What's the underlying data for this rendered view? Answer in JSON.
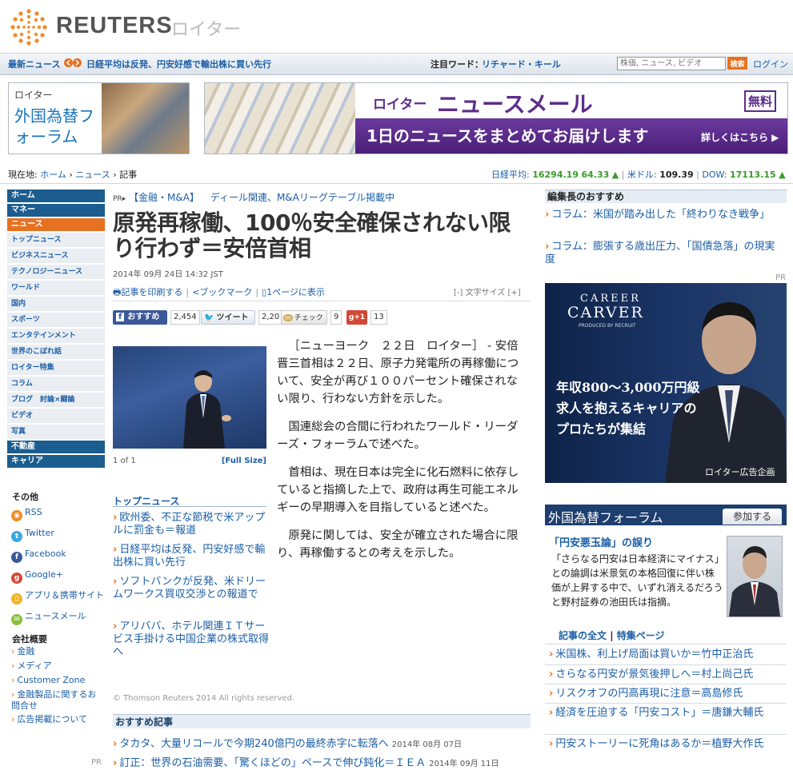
{
  "header": {
    "logo_text": "REUTERS",
    "logo_jp": "ロイター"
  },
  "topbar": {
    "breaking_label": "最新ニュース",
    "breaking_headline": "日経平均は反発、円安好感で輸出株に買い先行",
    "watch_label": "注目ワード：",
    "watch_word": "リチャード・キール",
    "search_placeholder": "株価, ニュース, ビデオ",
    "search_button": "検索",
    "login": "ログイン"
  },
  "banners": {
    "fx_reuters": "ロイター",
    "fx_title": "外国為替フォーラム",
    "mail_reuters": "ロイター",
    "mail_title": "ニュースメール",
    "mail_free": "無料",
    "mail_tagline": "1日のニュースをまとめてお届けします",
    "mail_more": "詳しくはこちら ▶"
  },
  "breadcrumb": {
    "label": "現在地: ",
    "items": [
      "ホーム",
      "ニュース",
      "記事"
    ],
    "sep": " › "
  },
  "markets": {
    "nikkei_label": "日経平均:",
    "nikkei_value": "16294.19",
    "nikkei_change": "64.33",
    "usd_label": "米ドル:",
    "usd_value": "109.39",
    "dow_label": "DOW:",
    "dow_value": "17113.15"
  },
  "leftnav": {
    "home": "ホーム",
    "money": "マネー",
    "news": "ニュース",
    "items": [
      "トップニュース",
      "ビジネスニュース",
      "テクノロジーニュース",
      "ワールド",
      "国内",
      "スポーツ",
      "エンタテインメント",
      "世界のこぼれ話",
      "ロイター特集",
      "コラム",
      "ブログ　討論×闘論",
      "ビデオ",
      "写真"
    ],
    "realestate": "不動産",
    "career": "キャリア",
    "other_title": "その他",
    "social": [
      "RSS",
      "Twitter",
      "Facebook",
      "Google+",
      "アプリ＆携帯サイト",
      "ニュースメール"
    ],
    "company_title": "会社概要",
    "company_items": [
      "金融",
      "メディア",
      "Customer Zone",
      "金融製品に関するお問合せ",
      "広告掲載について"
    ],
    "pr": "PR"
  },
  "article": {
    "pr_badge": "PR",
    "pr_tag": "【金融・M&A】",
    "pr_text": "ディール関連、M&Aリーグテーブル掲載中",
    "headline": "原発再稼働、100％安全確保されない限り行わず＝安倍首相",
    "date": "2014年 09月 24日 14:32 JST",
    "print": "記事を印刷する",
    "bookmark": "ブックマーク",
    "onepage": "1ページに表示",
    "font_size": "[-] 文字サイズ [+]",
    "share": {
      "fb_label": "おすすめ",
      "fb_count": "2,454",
      "tw_label": "ツイート",
      "tw_count": "2,20",
      "hatena_label": "チェック",
      "hatena_count": "9",
      "gplus_label": "g+1",
      "gplus_count": "13"
    },
    "photo_count": "1 of 1",
    "photo_full": "[Full Size]",
    "paragraphs": [
      "［ニューヨーク　２２日　ロイター］ - 安倍晋三首相は２２日、原子力発電所の再稼働について、安全が再び１００パーセント確保されない限り、行わない方針を示した。",
      "国連総会の合間に行われたワールド・リーダーズ・フォーラムで述べた。",
      "首相は、現在日本は完全に化石燃料に依存していると指摘した上で、政府は再生可能エネルギーの早期導入を目指していると述べた。",
      "原発に関しては、安全が確立された場合に限り、再稼働するとの考えを示した。"
    ],
    "copyright": "© Thomson Reuters 2014 All rights reserved."
  },
  "related": {
    "title": "トップニュース",
    "items": [
      "欧州委、不正な節税で米アップルに罰金も＝報道",
      "日経平均は反発、円安好感で輸出株に買い先行",
      "ソフトバンクが反発、米ドリームワークス買収交渉との報道で",
      "アリババ、ホテル関連ＩＴサービス手掛ける中国企業の株式取得へ"
    ]
  },
  "recommended": {
    "title": "おすすめ記事",
    "items": [
      {
        "text": "タカタ、大量リコールで今期240億円の最終赤字に転落へ",
        "date": "2014年 08月 07日"
      },
      {
        "text": "訂正：世界の石油需要、「驚くほどの」ペースで伸び鈍化＝ＩＥＡ",
        "date": "2014年 09月 11日"
      }
    ]
  },
  "editor": {
    "title": "編集長のおすすめ",
    "items": [
      "コラム：米国が踏み出した「終わりなき戦争」",
      "コラム：膨張する歳出圧力、「国債急落」の現実度"
    ],
    "pr": "PR"
  },
  "ad_career": {
    "logo1": "CAREER",
    "logo2": "CARVER",
    "logo3": "PRODUCED BY RECRUIT",
    "copy": [
      "年収800～3,000万円級",
      "求人を抱えるキャリアの",
      "プロたちが集結"
    ],
    "foot": "ロイター広告企画"
  },
  "fx_forum": {
    "title": "外国為替フォーラム",
    "join": "参加する",
    "lead_title": "「円安悪玉論」の誤り",
    "lead_body": "「さらなる円安は日本経済にマイナス」との論調は米景気の本格回復に伴い株価が上昇する中で、いずれ消えるだろうと野村証券の池田氏は指摘。",
    "link_full": "記事の全文",
    "link_sep": " | ",
    "link_special": "特集ページ",
    "items": [
      "米国株、利上げ局面は買いか＝竹中正治氏",
      "さらなる円安が景気後押しへ＝村上尚己氏",
      "リスクオフの円高再現に注意＝高島修氏",
      "経済を圧迫する「円安コスト」＝唐鎌大輔氏",
      "円安ストーリーに死角はあるか＝植野大作氏"
    ]
  },
  "colors": {
    "reuters_orange": "#e57221",
    "nav_blue": "#1b5d8f",
    "link_blue": "#1b5ea6",
    "mail_purple": "#5c2d8c"
  }
}
